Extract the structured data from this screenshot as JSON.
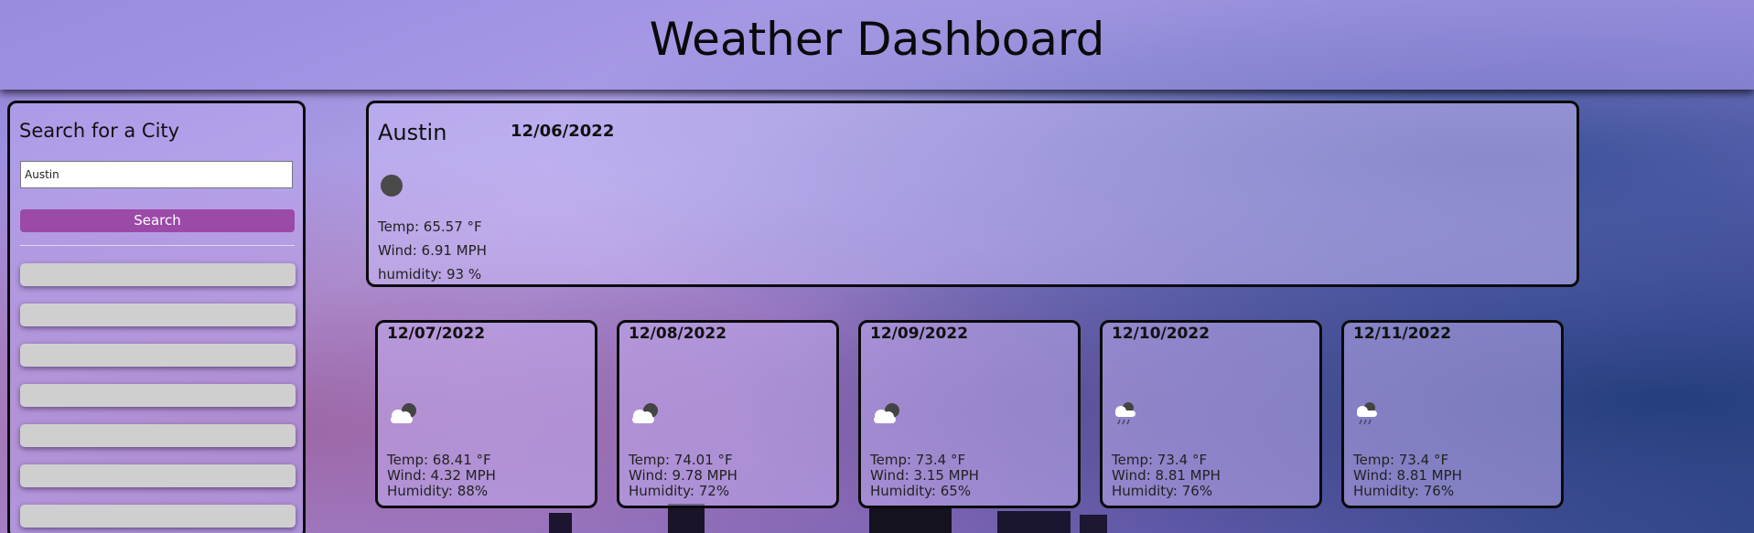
{
  "header": {
    "title": "Weather Dashboard"
  },
  "sidebar": {
    "heading": "Search for a City",
    "search_value": "Austin",
    "search_button": "Search",
    "history_count_visible": 7
  },
  "current": {
    "city": "Austin",
    "date": "12/06/2022",
    "icon": "dark-circle-icon",
    "temp": "Temp: 65.57 °F",
    "wind": "Wind: 6.91 MPH",
    "humidity": "humidity: 93 %"
  },
  "forecast": [
    {
      "date": "12/07/2022",
      "icon": "cloudy-icon",
      "temp": "Temp: 68.41 °F",
      "wind": "Wind: 4.32 MPH",
      "humidity": "Humidity: 88%"
    },
    {
      "date": "12/08/2022",
      "icon": "cloudy-icon",
      "temp": "Temp: 74.01 °F",
      "wind": "Wind: 9.78 MPH",
      "humidity": "Humidity: 72%"
    },
    {
      "date": "12/09/2022",
      "icon": "cloudy-icon",
      "temp": "Temp: 73.4 °F",
      "wind": "Wind: 3.15 MPH",
      "humidity": "Humidity: 65%"
    },
    {
      "date": "12/10/2022",
      "icon": "rain-cloud-icon",
      "temp": "Temp: 73.4 °F",
      "wind": "Wind: 8.81 MPH",
      "humidity": "Humidity: 76%"
    },
    {
      "date": "12/11/2022",
      "icon": "rain-cloud-icon",
      "temp": "Temp: 73.4 °F",
      "wind": "Wind: 8.81 MPH",
      "humidity": "Humidity: 76%"
    }
  ],
  "colors": {
    "search_button": "#9b4aa8",
    "history_button": "#d0cfd0",
    "panel_border": "#0b0b0b"
  }
}
